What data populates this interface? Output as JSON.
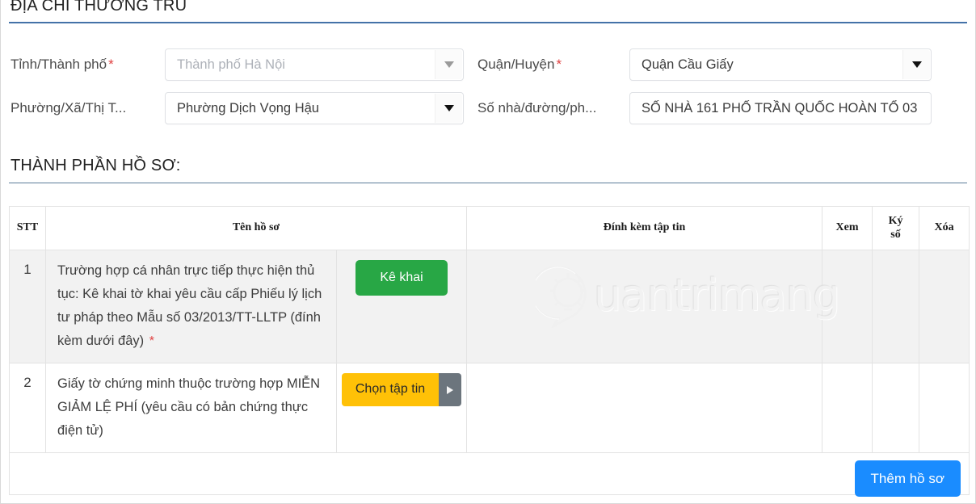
{
  "sections": {
    "address": {
      "title": "ĐỊA CHỈ THƯỜNG TRÚ"
    },
    "documents": {
      "title": "THÀNH PHẦN HỒ SƠ:"
    }
  },
  "form": {
    "province": {
      "label": "Tỉnh/Thành phố",
      "required_mark": "*",
      "value": "Thành phố Hà Nội",
      "placeholder": "Thành phố Hà Nội",
      "is_placeholder": true,
      "caret_icon": "chevron-down-icon"
    },
    "district": {
      "label": "Quận/Huyện",
      "required_mark": "*",
      "value": "Quận Cầu Giấy",
      "caret_icon": "chevron-down-icon"
    },
    "ward": {
      "label": "Phường/Xã/Thị T...",
      "value": "Phường Dịch Vọng Hậu",
      "caret_icon": "chevron-down-icon"
    },
    "street": {
      "label": "Số nhà/đường/ph...",
      "value": "SỐ NHÀ 161 PHỐ TRẦN QUỐC HOÀN TỔ 03"
    }
  },
  "table": {
    "headers": {
      "stt": "STT",
      "name": "Tên hồ sơ",
      "file": "Đính kèm tập tin",
      "view": "Xem",
      "sign_l1": "Ký",
      "sign_l2": "số",
      "delete": "Xóa"
    },
    "rows": [
      {
        "stt": "1",
        "name": "Trường hợp cá nhân trực tiếp thực hiện thủ tục: Kê khai tờ khai yêu cầu cấp Phiếu lý lịch tư pháp theo Mẫu số 03/2013/TT-LLTP (đính kèm dưới đây)",
        "required_mark": "*",
        "action_label": "Kê khai",
        "action_style": "green",
        "shaded": true
      },
      {
        "stt": "2",
        "name": "Giấy tờ chứng minh thuộc trường hợp MIỄN GIẢM LỆ PHÍ (yêu cầu có bản chứng thực điện tử)",
        "required_mark": "",
        "action_label": "Chọn tập tin",
        "action_style": "yellow",
        "action_caret_icon": "caret-right-icon",
        "shaded": false
      }
    ]
  },
  "actions": {
    "add_record": "Thêm hồ sơ"
  },
  "watermark": {
    "text": "uantrimang",
    "logo_icon": "lightbulb-speech-bubble-icon"
  },
  "colors": {
    "accent_blue": "#1a8cff",
    "rule_blue": "#4472a8",
    "green": "#28a745",
    "yellow": "#ffc107",
    "gray": "#6c757d",
    "required_red": "#e04141",
    "row_shaded": "#f2f2f2"
  }
}
